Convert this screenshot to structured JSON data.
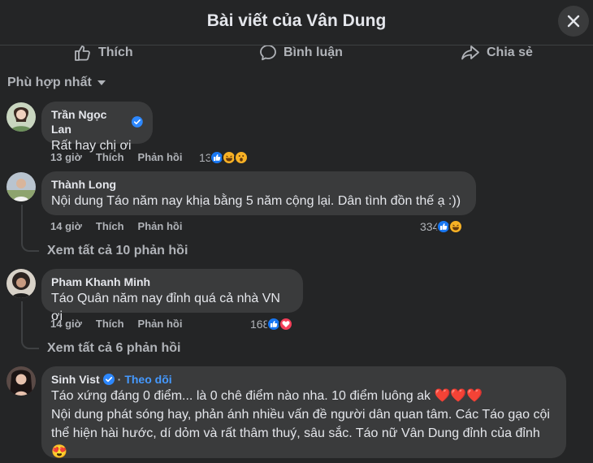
{
  "header": {
    "title": "Bài viết của Vân Dung"
  },
  "actions": {
    "like": "Thích",
    "comment": "Bình luận",
    "share": "Chia sẻ"
  },
  "sort": {
    "label": "Phù hợp nhất"
  },
  "colors": {
    "bg": "#242526",
    "bubble": "#3a3b3c",
    "like_blue": "#1877f2",
    "love_red": "#f33e58",
    "verified": "#2d88ff"
  },
  "comments": [
    {
      "author": "Trần Ngọc Lan",
      "verified": true,
      "text": "Rất hay chị ơi",
      "time": "13 giờ",
      "like": "Thích",
      "reply": "Phản hồi",
      "reaction_count": "13",
      "reactions": [
        "like-icon",
        "haha-icon",
        "wow-icon"
      ]
    },
    {
      "author": "Thành Long",
      "text": "Nội dung Táo năm nay khịa bằng 5 năm cộng lại. Dân tình đồn thế ạ :))",
      "time": "14 giờ",
      "like": "Thích",
      "reply": "Phản hồi",
      "reaction_count": "334",
      "reactions": [
        "like-icon",
        "haha-icon"
      ],
      "view_replies": "Xem tất cả 10 phản hồi"
    },
    {
      "author": "Pham Khanh Minh",
      "text": "Táo Quân năm nay đỉnh quá cả nhà VN ơi",
      "time": "14 giờ",
      "like": "Thích",
      "reply": "Phản hồi",
      "reaction_count": "168",
      "reactions": [
        "like-icon",
        "love-icon"
      ],
      "view_replies": "Xem tất cả 6 phản hồi"
    },
    {
      "author": "Sinh Vist",
      "verified": true,
      "separator": "·",
      "follow": "Theo dõi",
      "lines": [
        "Táo xứng đáng 0 điểm... là 0 chê điểm nào nha. 10 điểm luông ak ❤️❤️❤️",
        "Nội dung phát sóng hay, phản ánh nhiều vấn đề người dân quan tâm. Các Táo gạo cội",
        "thể hiện hài hước, dí dỏm và rất thâm thuý, sâu sắc. Táo nữ Vân Dung đỉnh của đỉnh",
        "😍"
      ]
    }
  ]
}
